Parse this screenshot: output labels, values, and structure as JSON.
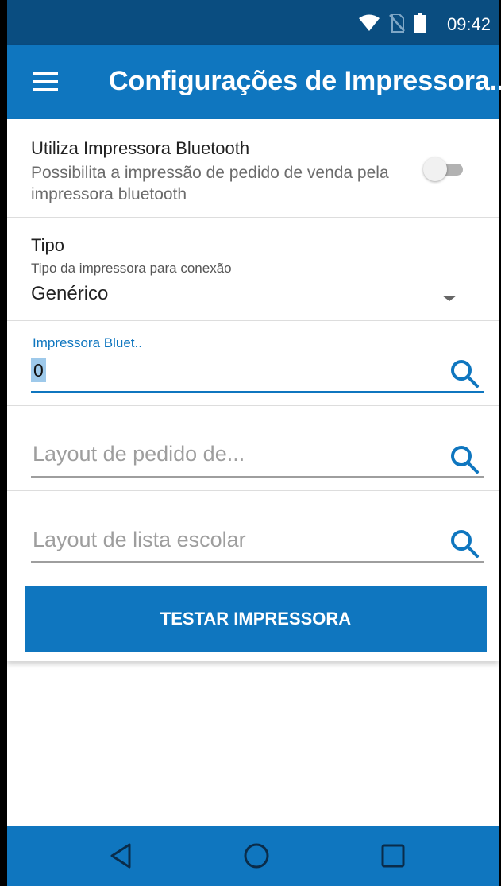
{
  "status_bar": {
    "time": "09:42",
    "icons": [
      "wifi-icon",
      "no-sim-icon",
      "battery-icon"
    ],
    "color": "#0a4d80"
  },
  "app_bar": {
    "title": "Configurações de Impressora...",
    "menu_icon": "menu-icon",
    "color": "#0f76bf"
  },
  "settings": {
    "bluetooth": {
      "title": "Utiliza Impressora Bluetooth",
      "description": "Possibilita a impressão de pedido de venda pela impressora bluetooth",
      "enabled": false
    },
    "tipo": {
      "title": "Tipo",
      "subtitle": "Tipo da impressora para conexão",
      "selected": "Genérico"
    },
    "printer_field": {
      "label": "Impressora Bluet..",
      "value": "0",
      "icon": "search-icon"
    },
    "order_layout_field": {
      "placeholder": "Layout de pedido de...",
      "icon": "search-icon"
    },
    "school_list_layout_field": {
      "placeholder": "Layout de lista escolar",
      "icon": "search-icon"
    },
    "test_button": {
      "label": "TESTAR IMPRESSORA"
    }
  },
  "nav_bar": {
    "buttons": [
      "back-icon",
      "home-icon",
      "recents-icon"
    ],
    "color": "#0f76bf"
  },
  "accent_color": "#0f76bf"
}
